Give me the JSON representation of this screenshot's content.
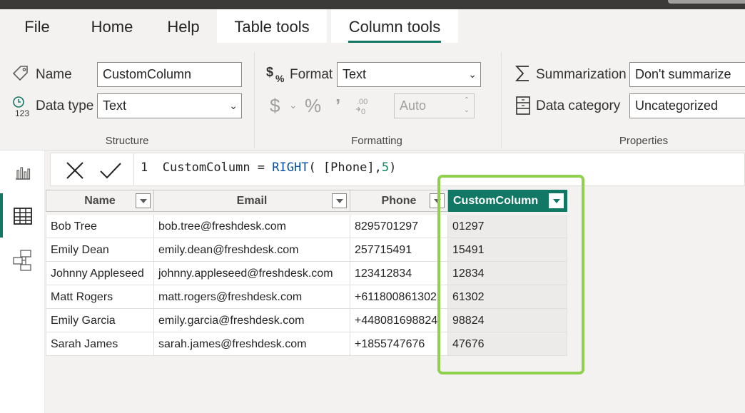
{
  "ribbon": {
    "tabs": [
      "File",
      "Home",
      "Help",
      "Table tools",
      "Column tools"
    ],
    "structure": {
      "name_label": "Name",
      "name_value": "CustomColumn",
      "datatype_label": "Data type",
      "datatype_value": "Text",
      "group_label": "Structure"
    },
    "formatting": {
      "format_label": "Format",
      "format_value": "Text",
      "decimal_value": "Auto",
      "group_label": "Formatting"
    },
    "properties": {
      "summarization_label": "Summarization",
      "summarization_value": "Don't summarize",
      "category_label": "Data category",
      "category_value": "Uncategorized",
      "group_label": "Properties"
    }
  },
  "formula": {
    "line": "1",
    "before": "CustomColumn = ",
    "fn": "RIGHT",
    "args": "( [Phone],",
    "num": "5",
    "close": ")"
  },
  "table": {
    "columns": [
      "Name",
      "Email",
      "Phone",
      "CustomColumn"
    ],
    "rows": [
      [
        "Bob Tree",
        "bob.tree@freshdesk.com",
        "8295701297",
        "01297"
      ],
      [
        "Emily Dean",
        "emily.dean@freshdesk.com",
        "257715491",
        "15491"
      ],
      [
        "Johnny Appleseed",
        "johnny.appleseed@freshdesk.com",
        "123412834",
        "12834"
      ],
      [
        "Matt Rogers",
        "matt.rogers@freshdesk.com",
        "+611800861302",
        "61302"
      ],
      [
        "Emily Garcia",
        "emily.garcia@freshdesk.com",
        "+448081698824",
        "98824"
      ],
      [
        "Sarah James",
        "sarah.james@freshdesk.com",
        "+1855747676",
        "47676"
      ]
    ]
  },
  "icons": {
    "name": "tag-icon",
    "datatype": "datatype-123-icon",
    "format": "format-icon",
    "summarization": "sigma-icon",
    "category": "data-category-icon",
    "report": "report-view-icon",
    "data": "table-view-icon",
    "model": "model-view-icon"
  },
  "colors": {
    "accent": "#117865",
    "highlight": "#8fd14f"
  }
}
